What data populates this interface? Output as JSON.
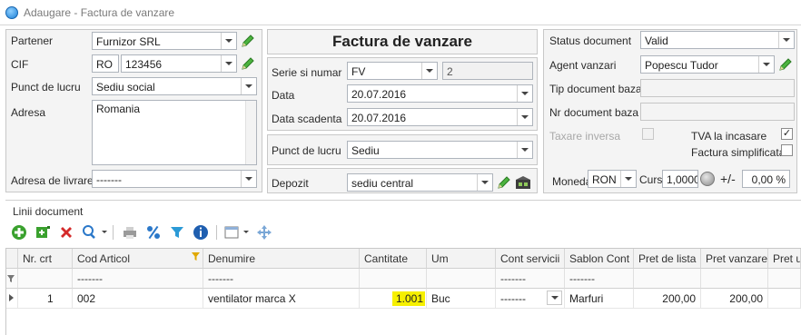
{
  "window": {
    "title": "Adaugare - Factura de vanzare"
  },
  "partner": {
    "partener_label": "Partener",
    "partener_value": "Furnizor SRL",
    "cif_label": "CIF",
    "cif_prefix": "RO",
    "cif_value": "123456",
    "punct_label": "Punct de lucru",
    "punct_value": "Sediu social",
    "adresa_label": "Adresa",
    "adresa_value": "Romania",
    "livrare_label": "Adresa de livrare",
    "livrare_value": "-------"
  },
  "document": {
    "heading": "Factura de vanzare",
    "serie_label": "Serie si numar",
    "serie_value": "FV",
    "numar_value": "2",
    "data_label": "Data",
    "data_value": "20.07.2016",
    "scadenta_label": "Data scadenta",
    "scadenta_value": "20.07.2016",
    "punct_label": "Punct de lucru",
    "punct_value": "Sediu",
    "depozit_label": "Depozit",
    "depozit_value": "sediu central"
  },
  "status": {
    "status_label": "Status document",
    "status_value": "Valid",
    "agent_label": "Agent vanzari",
    "agent_value": "Popescu Tudor",
    "tip_label": "Tip document baza",
    "tip_value": "",
    "nr_label": "Nr document baza",
    "nr_value": "",
    "taxare_label": "Taxare inversa",
    "taxare_checked": false,
    "tva_label": "TVA la incasare",
    "tva_checked": true,
    "simplificata_label": "Factura simplificata",
    "simplificata_checked": false,
    "moneda_label": "Moneda",
    "moneda_value": "RON",
    "curs_label": "Curs",
    "curs_value": "1,0000",
    "plusminus_label": "+/-",
    "percent_value": "0,00 %"
  },
  "lines": {
    "section_title": "Linii document",
    "toolbar_icons": [
      "add-icon",
      "add-multiple-icon",
      "delete-icon",
      "search-icon",
      "print-icon",
      "percent-icon",
      "filter-icon",
      "info-icon",
      "layout-icon",
      "move-icon"
    ],
    "columns": [
      "Nr. crt",
      "Cod Articol",
      "Denumire",
      "Cantitate",
      "Um",
      "Cont servicii",
      "Sablon Cont",
      "Pret de lista",
      "Pret vanzare",
      "Pret u"
    ],
    "filter_row": [
      "",
      "-------",
      "-------",
      "",
      "",
      "-------",
      "-------",
      "",
      "",
      ""
    ],
    "rows": [
      {
        "nr": "1",
        "cod": "002",
        "denumire": "ventilator marca X",
        "cantitate": "1.001",
        "um": "Buc",
        "cont": "-------",
        "sablon": "Marfuri",
        "pret_lista": "200,00",
        "pret_vanzare": "200,00",
        "pret_u": ""
      }
    ]
  },
  "colors": {
    "highlight": "#f6f000",
    "accent": "#1c7fd6",
    "pencil": "#3aa12e"
  }
}
